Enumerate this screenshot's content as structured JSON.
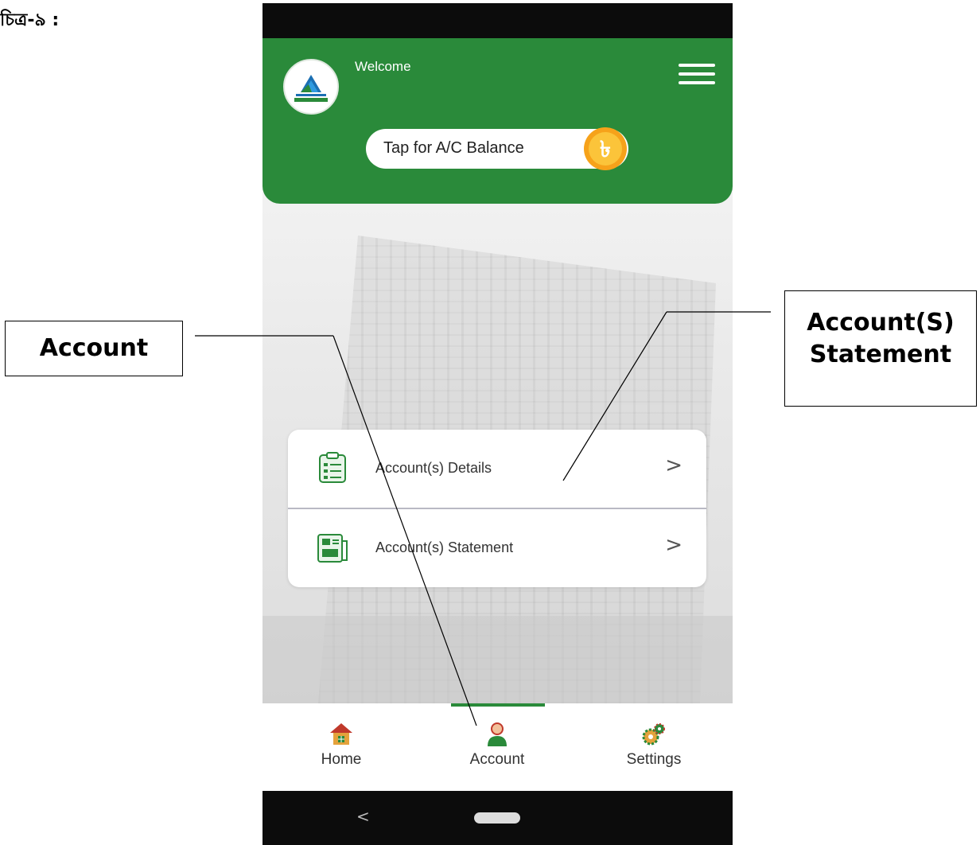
{
  "figure_label": "চিত্র-৯ :",
  "header": {
    "welcome": "Welcome",
    "balance_button": "Tap for A/C Balance",
    "brand_color": "#2a8a3a"
  },
  "menu": {
    "items": [
      {
        "label": "Account(s) Details",
        "icon": "clipboard-list-icon"
      },
      {
        "label": "Account(s) Statement",
        "icon": "statement-document-icon"
      }
    ],
    "chevron": ">"
  },
  "nav": {
    "items": [
      {
        "label": "Home",
        "icon": "home-icon"
      },
      {
        "label": "Account",
        "icon": "user-icon",
        "active": true
      },
      {
        "label": "Settings",
        "icon": "gears-icon"
      }
    ]
  },
  "system_bar": {
    "back": "<"
  },
  "callouts": {
    "left": "Account",
    "right_line1": "Account(S)",
    "right_line2": "Statement"
  }
}
